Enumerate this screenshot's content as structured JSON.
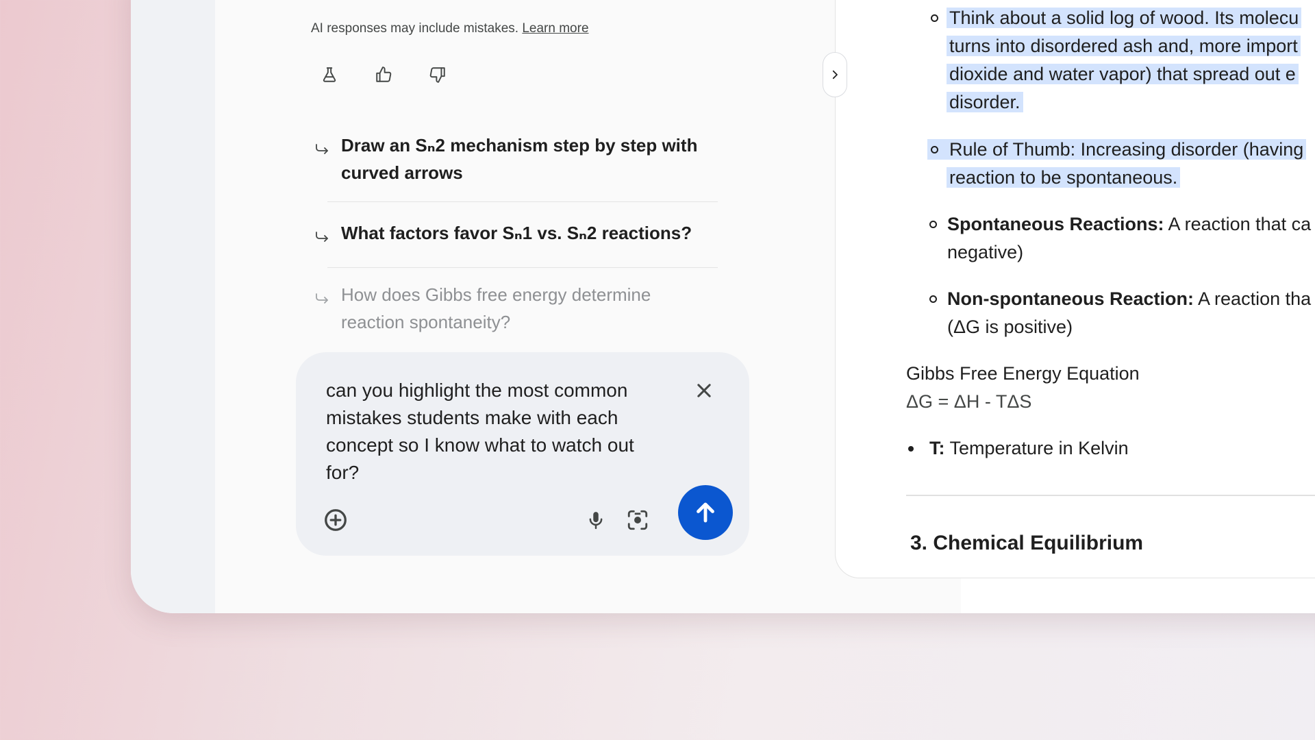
{
  "disclaimer": {
    "text": "AI responses may include mistakes. ",
    "link": "Learn more"
  },
  "feedback_icons": [
    "flask-icon",
    "thumbs-up-icon",
    "thumbs-down-icon"
  ],
  "suggestions": [
    {
      "line1": "Draw an Sₙ2 mechanism step by step with",
      "line2": " curved arrows"
    },
    {
      "line1": "What factors favor Sₙ1 vs. Sₙ2 reactions?"
    },
    {
      "line1": "How does Gibbs free energy determine",
      "line2": "reaction spontaneity?"
    }
  ],
  "composer": {
    "query": "can you highlight the most common mistakes students make with each concept so I know what to watch out for?"
  },
  "doc": {
    "wood_l1": "Think about a solid log of wood. Its molecu",
    "wood_l2": "turns into disordered ash and, more import",
    "wood_l3": "dioxide and water vapor) that spread out e",
    "wood_l4": "disorder.",
    "thumb_l1": "Rule of Thumb: Increasing disorder (having",
    "thumb_l2": "reaction to be spontaneous.",
    "spont_label": "Spontaneous Reactions:",
    "spont_l1": " A reaction that ca",
    "spont_l2": "negative)",
    "nonspont_label": "Non-spontaneous Reaction:",
    "nonspont_l1": " A reaction tha",
    "nonspont_l2": "(ΔG is positive)",
    "gibbs_title": "Gibbs Free Energy Equation",
    "gibbs_eq": "ΔG = ΔH - TΔS",
    "t_label": "T:",
    "t_text": " Temperature in Kelvin",
    "section3": "3. Chemical Equilibrium"
  },
  "colors": {
    "accent": "#0b57d0",
    "highlight": "#d3e3fd"
  }
}
